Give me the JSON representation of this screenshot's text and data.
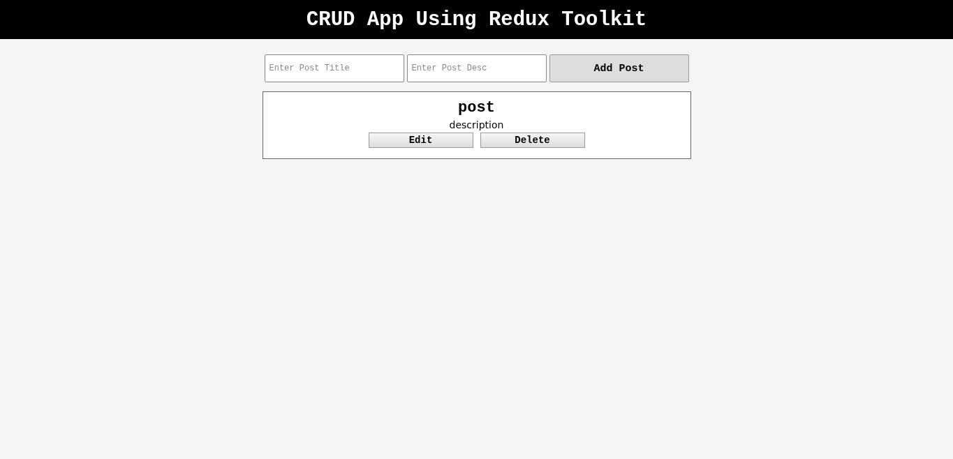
{
  "header": {
    "title": "CRUD App Using Redux Toolkit"
  },
  "form": {
    "title_field": {
      "placeholder": "Enter Post Title"
    },
    "desc_field": {
      "placeholder": "Enter Post Desc"
    },
    "submit": "Add Post"
  },
  "posts": [
    {
      "title": "post",
      "description": "description",
      "actions": [
        "Edit",
        "Delete"
      ]
    }
  ]
}
